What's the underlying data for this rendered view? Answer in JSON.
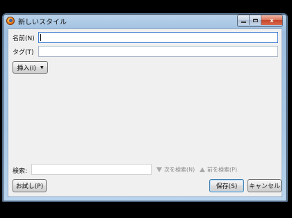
{
  "window": {
    "title": "新しいスタイル",
    "app_icon": "firefox-icon"
  },
  "form": {
    "name_label": "名前(N)",
    "name_value": "",
    "tag_label": "タグ(T)",
    "tag_value": "",
    "insert_button": "挿入(I)",
    "insert_arrow": "▼"
  },
  "find_bar": {
    "label": "検索:",
    "value": "",
    "next_label": "次を検索(N)",
    "prev_label": "前を検索(P)"
  },
  "footer": {
    "preview_button": "お試し(P)",
    "save_button": "保存(S)",
    "cancel_button": "キャンセル"
  },
  "caption": {
    "close_glyph": "x"
  }
}
